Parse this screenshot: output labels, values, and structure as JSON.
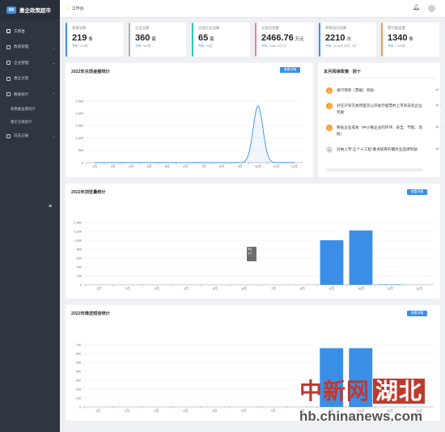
{
  "brand": {
    "logo_text": "招商",
    "title": "惠企政策超市"
  },
  "sidebar": {
    "items": [
      {
        "label": "工作台",
        "icon": "home-icon",
        "active": true
      },
      {
        "label": "政策管理",
        "icon": "document-icon",
        "chevron": "⌄"
      },
      {
        "label": "企业管理",
        "icon": "building-icon",
        "chevron": "⌄"
      },
      {
        "label": "惠企兑现",
        "icon": "cash-icon"
      },
      {
        "label": "数据统计",
        "icon": "chart-icon",
        "chevron": "⌃"
      }
    ],
    "subitems": [
      {
        "label": "政策推送量统计"
      },
      {
        "label": "惠企兑现统计"
      }
    ],
    "extra": {
      "label": "日志记录",
      "icon": "log-icon",
      "chevron": "⌄"
    }
  },
  "topbar": {
    "crumb": "工作台"
  },
  "cards": [
    {
      "label": "政策总数",
      "value": "219",
      "unit": "条",
      "sub_key": "今年:",
      "sub_val": "219条",
      "color": "#3a8ee6"
    },
    {
      "label": "企业总数",
      "value": "360",
      "unit": "家",
      "sub_key": "今年:",
      "sub_val": "360家",
      "color": "#a8b0bb"
    },
    {
      "label": "兑现企业总数",
      "value": "65",
      "unit": "家",
      "sub_key": "今年:",
      "sub_val": "65家",
      "color": "#2fc4b2"
    },
    {
      "label": "兑现总金额",
      "value": "2466.76",
      "unit": "万元",
      "sub_key": "今年:",
      "sub_val": "2466.76万元",
      "color": "#f07aa8"
    },
    {
      "label": "政策访问总数",
      "value": "2210",
      "unit": "次",
      "sub_key": "今年:",
      "sub_val": "2210次  本月: 5次",
      "color": "#3a8ee6"
    },
    {
      "label": "累计推送量",
      "value": "1340",
      "unit": "条",
      "sub_key": "今年:",
      "sub_val": "1340条",
      "color": "#f0a040"
    }
  ],
  "panels": {
    "amount": {
      "title": "2022年兑现金额统计",
      "button": "查看详情"
    },
    "ranking": {
      "title": "本月阅读政策 · 前十"
    },
    "visits": {
      "title": "2022年浏览量统计",
      "button": "查看详情"
    },
    "push": {
      "title": "2022年推送短信统计",
      "button": "查看详情"
    }
  },
  "ranking_items": [
    {
      "num": "1",
      "text": "发行债券（票据）奖励",
      "count": "1"
    },
    {
      "num": "2",
      "text": "对在沪深交易所首次公开发行股票并上市的非农企业奖励",
      "count": "1"
    },
    {
      "num": "3",
      "text": "降低企业成本（中小微企业的环评、安全、节能、消防）",
      "count": "1"
    },
    {
      "num": "4",
      "text": "对纳入市\"五个十工程\"重点培育的服务业品牌奖励",
      "count": "1"
    }
  ],
  "tooltip": {
    "month": "8月",
    "value": "0"
  },
  "chart_data": [
    {
      "type": "area",
      "title": "2022年兑现金额统计",
      "categories": [
        "1月",
        "2月",
        "3月",
        "4月",
        "5月",
        "6月",
        "7月",
        "8月",
        "9月",
        "10月",
        "11月",
        "12月"
      ],
      "values": [
        0,
        0,
        0,
        0,
        0,
        0,
        0,
        0,
        0,
        2300,
        0,
        0
      ],
      "ylim": [
        0,
        2500
      ],
      "yticks": [
        "0",
        "500",
        "1,000",
        "1,500",
        "2,000",
        "2,500"
      ],
      "grid": true
    },
    {
      "type": "bar",
      "title": "2022年浏览量统计",
      "categories": [
        "1月",
        "2月",
        "3月",
        "4月",
        "5月",
        "6月",
        "7月",
        "8月",
        "9月",
        "10月",
        "11月",
        "12月"
      ],
      "values": [
        0,
        0,
        0,
        0,
        0,
        0,
        0,
        0,
        1000,
        1220,
        10,
        0
      ],
      "ylim": [
        0,
        1400
      ],
      "yticks": [
        "0",
        "200",
        "400",
        "600",
        "800",
        "1,000",
        "1,200",
        "1,400"
      ],
      "grid": true
    },
    {
      "type": "bar",
      "title": "2022年推送短信统计",
      "categories": [
        "1月",
        "2月",
        "3月",
        "4月",
        "5月",
        "6月",
        "7月",
        "8月",
        "9月",
        "10月",
        "11月",
        "12月"
      ],
      "values": [
        0,
        0,
        0,
        0,
        0,
        0,
        0,
        0,
        660,
        660,
        0,
        0
      ],
      "ylim": [
        0,
        700
      ],
      "yticks": [
        "0",
        "100",
        "200",
        "300",
        "400",
        "500",
        "600",
        "700"
      ],
      "grid": true
    }
  ],
  "watermark": {
    "cn": "中新网",
    "hb": "湖北",
    "url": "hb.chinanews.com"
  }
}
